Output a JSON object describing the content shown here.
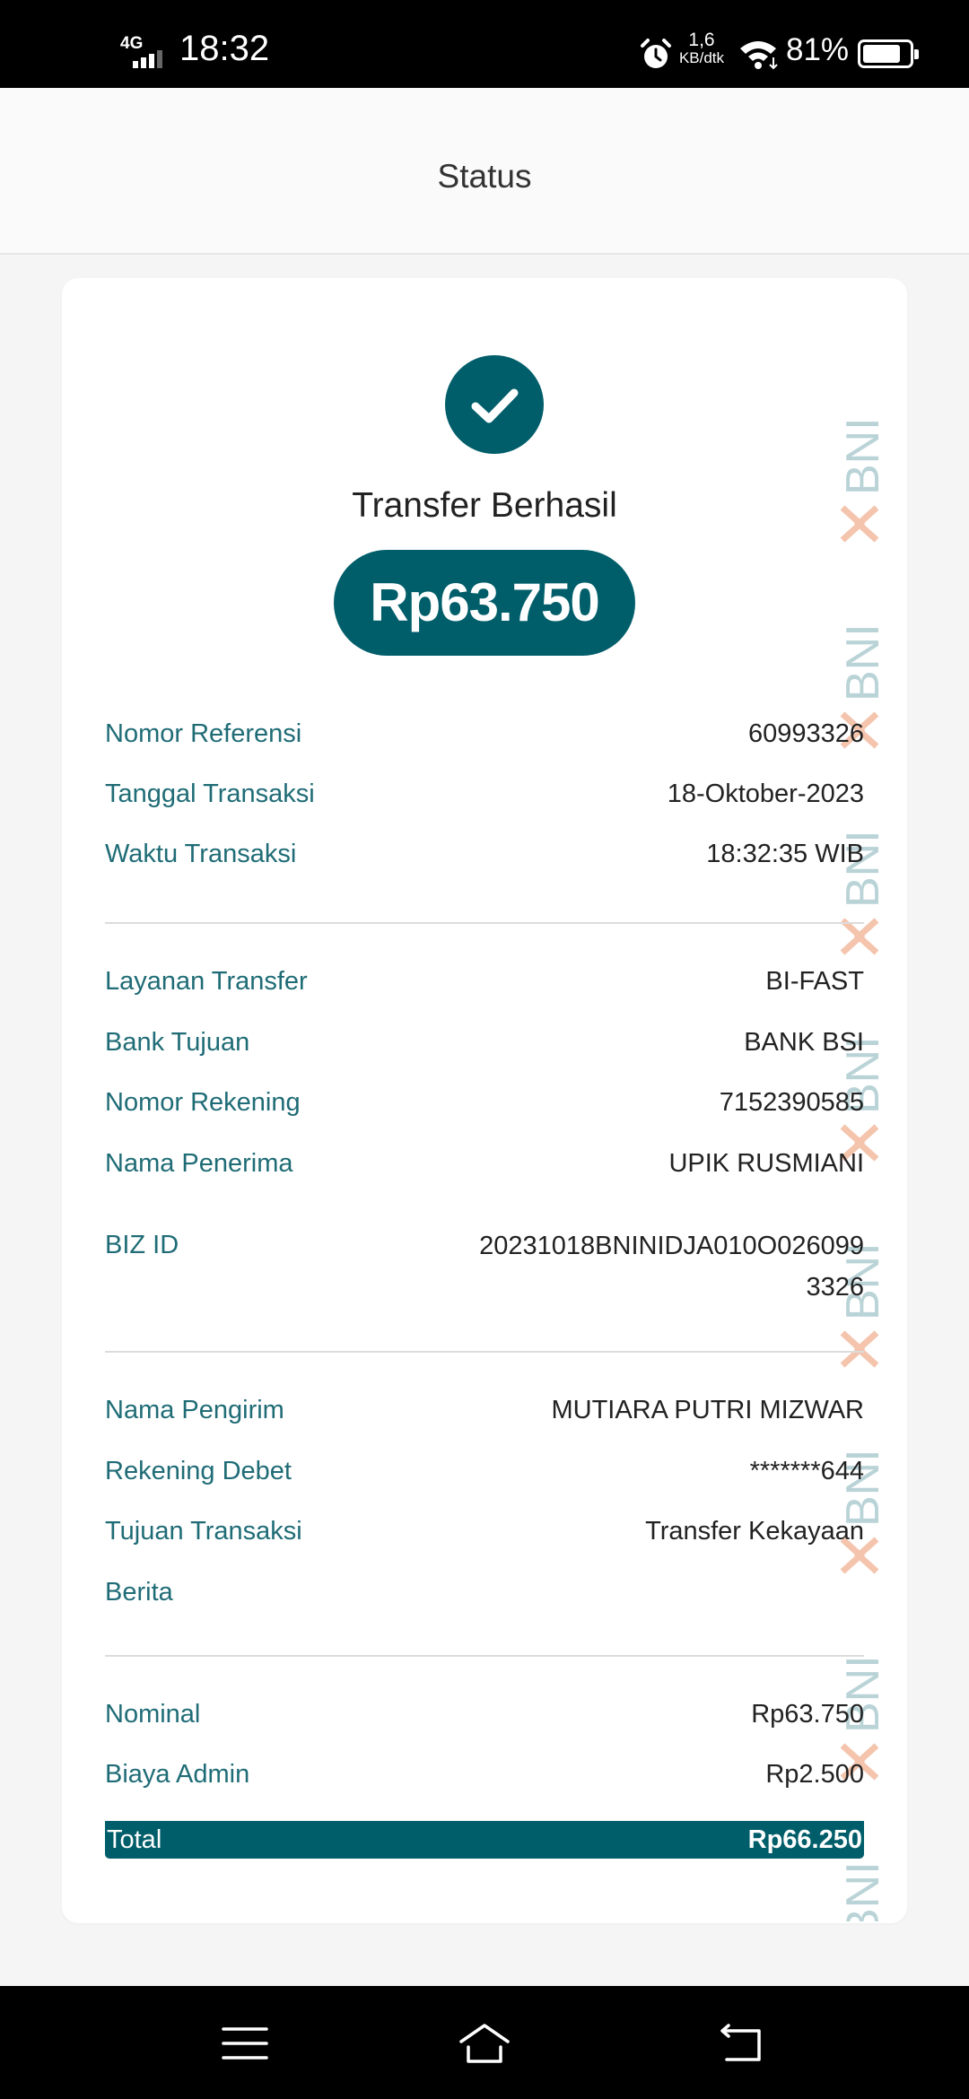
{
  "status_bar": {
    "network": "4G",
    "time": "18:32",
    "speed_value": "1,6",
    "speed_unit": "KB/dtk",
    "battery_percent": "81%",
    "battery_level": 0.81
  },
  "header": {
    "title": "Status"
  },
  "receipt": {
    "title": "Transfer Berhasil",
    "amount": "Rp63.750",
    "watermark_text": "BNI",
    "section1": [
      {
        "label": "Nomor Referensi",
        "value": "60993326"
      },
      {
        "label": "Tanggal Transaksi",
        "value": "18-Oktober-2023"
      },
      {
        "label": "Waktu Transaksi",
        "value": "18:32:35 WIB"
      }
    ],
    "section2": [
      {
        "label": "Layanan Transfer",
        "value": "BI-FAST"
      },
      {
        "label": "Bank Tujuan",
        "value": "BANK BSI"
      },
      {
        "label": "Nomor Rekening",
        "value": "7152390585"
      },
      {
        "label": "Nama Penerima",
        "value": "UPIK RUSMIANI"
      },
      {
        "label": "BIZ ID",
        "value": "20231018BNINIDJA010O0260993326"
      }
    ],
    "section3": [
      {
        "label": "Nama Pengirim",
        "value": "MUTIARA PUTRI MIZWAR"
      },
      {
        "label": "Rekening Debet",
        "value": "*******644"
      },
      {
        "label": "Tujuan Transaksi",
        "value": "Transfer Kekayaan"
      },
      {
        "label": "Berita",
        "value": ""
      }
    ],
    "section4": [
      {
        "label": "Nominal",
        "value": "Rp63.750"
      },
      {
        "label": "Biaya Admin",
        "value": "Rp2.500"
      }
    ],
    "total": {
      "label": "Total",
      "value": "Rp66.250"
    }
  },
  "colors": {
    "accent": "#005e6a",
    "label": "#1f6c76",
    "watermark_teal": "#b9d3d7",
    "watermark_orange": "#f4c4ad"
  },
  "icons": {
    "success": "check-circle-icon",
    "nav_menu": "menu-icon",
    "nav_home": "home-icon",
    "nav_back": "back-icon"
  }
}
